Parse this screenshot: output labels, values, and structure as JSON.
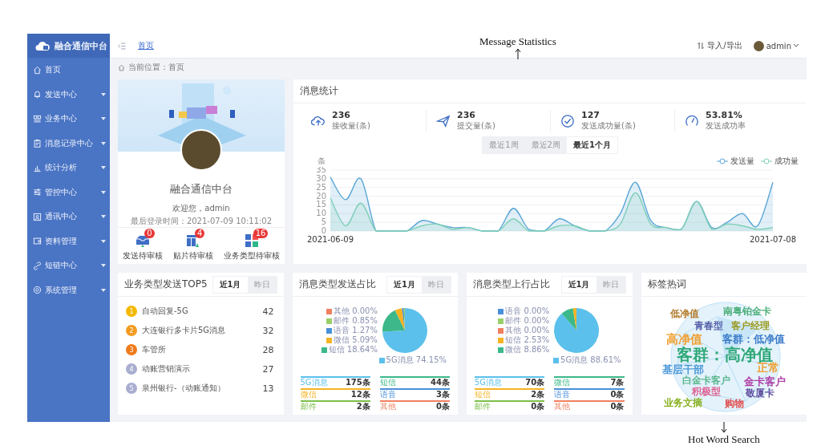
{
  "annotations": [
    {
      "kind": "up",
      "text": "Message Statistics"
    },
    {
      "kind": "down",
      "text": "Hot Word Search"
    }
  ],
  "sidebar": {
    "logo": "融合通信中台",
    "items": [
      {
        "label": "首页",
        "has_submenu": false
      },
      {
        "label": "发送中心",
        "has_submenu": true
      },
      {
        "label": "业务中心",
        "has_submenu": true
      },
      {
        "label": "消息记录中心",
        "has_submenu": true
      },
      {
        "label": "统计分析",
        "has_submenu": true
      },
      {
        "label": "管控中心",
        "has_submenu": true
      },
      {
        "label": "通讯中心",
        "has_submenu": true
      },
      {
        "label": "资料管理",
        "has_submenu": true
      },
      {
        "label": "短链中心",
        "has_submenu": true
      },
      {
        "label": "系统管理",
        "has_submenu": true
      }
    ]
  },
  "header": {
    "link": "首页",
    "import_export": "导入/导出",
    "user": "admin"
  },
  "breadcrumb": "当前位置：首页",
  "profile": {
    "name": "融合通信中台",
    "welcome": "欢迎您，admin",
    "last_login": "最后登录时间：2021-07-09 10:11:02",
    "tasks": [
      {
        "label": "发送待审核",
        "count": "0"
      },
      {
        "label": "贴片待审核",
        "count": "4"
      },
      {
        "label": "业务类型待审核",
        "count": "16"
      }
    ]
  },
  "message_stats": {
    "title": "消息统计",
    "stats": [
      {
        "value": "236",
        "label": "接收量(条)"
      },
      {
        "value": "236",
        "label": "提交量(条)"
      },
      {
        "value": "127",
        "label": "发送成功量(条)"
      },
      {
        "value": "53.81%",
        "label": "发送成功率"
      }
    ],
    "ranges": [
      {
        "label": "最近1周",
        "selected": false
      },
      {
        "label": "最近2周",
        "selected": false
      },
      {
        "label": "最近1个月",
        "selected": true
      }
    ],
    "chart_data": {
      "type": "area",
      "ylabel": "条",
      "ylim": [
        0,
        35
      ],
      "yticks": [
        0,
        5,
        10,
        15,
        20,
        25,
        30,
        35
      ],
      "grid": true,
      "legend": true,
      "categories": [
        "2021-06-09",
        null,
        null,
        null,
        null,
        null,
        null,
        null,
        null,
        null,
        null,
        null,
        null,
        null,
        null,
        null,
        null,
        null,
        null,
        null,
        null,
        null,
        null,
        null,
        null,
        null,
        null,
        null,
        null,
        "2021-07-08"
      ],
      "series": [
        {
          "name": "发送量",
          "color": "#5aa6d6",
          "values": [
            31,
            18,
            30,
            0,
            0,
            0,
            6,
            4,
            2,
            2,
            0,
            0,
            13,
            1,
            0,
            7,
            3,
            0,
            0,
            10,
            28,
            6,
            2,
            1,
            17,
            2,
            5,
            10,
            3,
            28
          ]
        },
        {
          "name": "成功量",
          "color": "#7fcfb8",
          "values": [
            19,
            3,
            16,
            0,
            0,
            0,
            3,
            4,
            1,
            2,
            0,
            0,
            7,
            0,
            0,
            3,
            3,
            0,
            0,
            4,
            22,
            4,
            2,
            1,
            17,
            1,
            4,
            3,
            1,
            2
          ]
        }
      ]
    }
  },
  "top5": {
    "title": "业务类型发送TOP5",
    "ranges": [
      {
        "label": "近1月",
        "selected": true
      },
      {
        "label": "昨日",
        "selected": false
      }
    ],
    "items": [
      {
        "rank": "1",
        "name": "自动回复-5G",
        "count": "42",
        "color": "#f5b800"
      },
      {
        "rank": "2",
        "name": "大连银行多卡片5G消息",
        "count": "32",
        "color": "#f39a1e"
      },
      {
        "rank": "3",
        "name": "车管所",
        "count": "28",
        "color": "#ef7a1a"
      },
      {
        "rank": "4",
        "name": "动账营销演示",
        "count": "27",
        "color": "#a9aed0"
      },
      {
        "rank": "5",
        "name": "泉州银行-（动账通知）",
        "count": "13",
        "color": "#a9aed0"
      }
    ]
  },
  "send_share": {
    "title": "消息类型发送占比",
    "ranges": [
      {
        "label": "近1月",
        "selected": true
      },
      {
        "label": "昨日",
        "selected": false
      }
    ],
    "chart_data": {
      "type": "pie",
      "categories": [
        "5G消息",
        "短信",
        "微信",
        "语音",
        "邮件",
        "其他"
      ],
      "values": [
        74.15,
        18.64,
        5.09,
        1.27,
        0.85,
        0
      ],
      "legend": true,
      "value_labels": [
        "74.15%",
        "18.64%",
        "5.09%",
        "1.27%",
        "0.85%",
        "0.00%"
      ],
      "colors": [
        "#5bc0eb",
        "#3cb88a",
        "#f5b324",
        "#4a90d9",
        "#9ad06a",
        "#f08060"
      ]
    },
    "legend": [
      {
        "label": "5G消息",
        "count": "175条",
        "color": "#5bc0eb"
      },
      {
        "label": "短信",
        "count": "44条",
        "color": "#3cb88a"
      },
      {
        "label": "微信",
        "count": "12条",
        "color": "#f5b324"
      },
      {
        "label": "语音",
        "count": "3条",
        "color": "#4a90d9"
      },
      {
        "label": "邮件",
        "count": "2条",
        "color": "#7cbf4a"
      },
      {
        "label": "其他",
        "count": "0条",
        "color": "#f08060"
      }
    ]
  },
  "upstream_share": {
    "title": "消息类型上行占比",
    "ranges": [
      {
        "label": "近1月",
        "selected": true
      },
      {
        "label": "昨日",
        "selected": false
      }
    ],
    "chart_data": {
      "type": "pie",
      "categories": [
        "5G消息",
        "微信",
        "短信",
        "其他",
        "邮件",
        "语音"
      ],
      "values": [
        88.61,
        8.86,
        2.53,
        0,
        0,
        0
      ],
      "legend": true,
      "value_labels": [
        "88.61%",
        "8.86%",
        "2.53%",
        "0.00%",
        "0.00%",
        "0.00%"
      ],
      "colors": [
        "#5bc0eb",
        "#3cb88a",
        "#f5b324",
        "#f08060",
        "#9ad06a",
        "#4a90d9"
      ]
    },
    "legend": [
      {
        "label": "5G消息",
        "count": "70条",
        "color": "#5bc0eb"
      },
      {
        "label": "微信",
        "count": "7条",
        "color": "#3cb88a"
      },
      {
        "label": "短信",
        "count": "2条",
        "color": "#f5b324"
      },
      {
        "label": "语音",
        "count": "0条",
        "color": "#4a90d9"
      },
      {
        "label": "邮件",
        "count": "0条",
        "color": "#7cbf4a"
      },
      {
        "label": "其他",
        "count": "0条",
        "color": "#f08060"
      }
    ]
  },
  "tag_cloud": {
    "title": "标签热词",
    "words": [
      {
        "text": "低净值",
        "color": "#b07a2a"
      },
      {
        "text": "南粤铂金卡",
        "color": "#4cb07a"
      },
      {
        "text": "青春型",
        "color": "#5560a8"
      },
      {
        "text": "客户经理",
        "color": "#9a9a20"
      },
      {
        "text": "高净值",
        "color": "#f0a030"
      },
      {
        "text": "客群：低净值",
        "color": "#3a7bc8"
      },
      {
        "text": "客群：高净值",
        "color": "#2fa878"
      },
      {
        "text": "正常",
        "color": "#f0a030"
      },
      {
        "text": "基层干部",
        "color": "#4a98d8"
      },
      {
        "text": "白金卡客户",
        "color": "#5cb890"
      },
      {
        "text": "金卡客户",
        "color": "#b040a8"
      },
      {
        "text": "积极型",
        "color": "#e06090"
      },
      {
        "text": "敬厦卡",
        "color": "#6050a0"
      },
      {
        "text": "业务文摘",
        "color": "#88b020"
      },
      {
        "text": "购物",
        "color": "#e05050"
      }
    ]
  }
}
